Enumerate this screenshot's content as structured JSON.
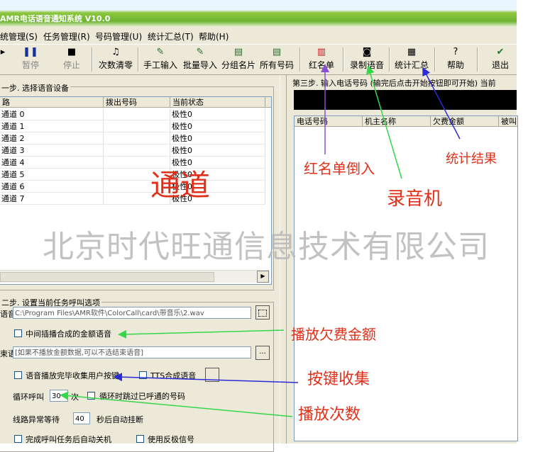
{
  "window": {
    "title": "AMR电话语音通知系统 V10.0"
  },
  "menu": [
    {
      "label": "统管理(S)"
    },
    {
      "label": "任务管理(R)"
    },
    {
      "label": "号码管理(U)"
    },
    {
      "label": "统计汇总(T)"
    },
    {
      "label": "帮助(H)"
    }
  ],
  "toolbar": [
    {
      "label": "",
      "icon": "run-icon"
    },
    {
      "label": "暂停",
      "icon": "pause-icon"
    },
    {
      "label": "停止",
      "icon": "stop-icon"
    },
    {
      "label": "次数清零",
      "icon": "music-note-icon"
    },
    {
      "label": "手工输入",
      "icon": "edit-icon"
    },
    {
      "label": "批量导入",
      "icon": "import-icon"
    },
    {
      "label": "分组名片",
      "icon": "card-icon"
    },
    {
      "label": "所有号码",
      "icon": "card-icon"
    },
    {
      "label": "红名单",
      "icon": "book-icon"
    },
    {
      "label": "录制语音",
      "icon": "recorder-icon"
    },
    {
      "label": "统计汇总",
      "icon": "stats-icon"
    },
    {
      "label": "帮助",
      "icon": "help-icon"
    },
    {
      "label": "退出",
      "icon": "check-icon"
    }
  ],
  "step1": {
    "title": "一步. 选择语音设备",
    "columns": [
      "路",
      "拨出号码",
      "当前状态"
    ],
    "rows": [
      {
        "line": "通道 0",
        "number": "",
        "status": "极性0"
      },
      {
        "line": "通道 1",
        "number": "",
        "status": "极性0"
      },
      {
        "line": "通道 2",
        "number": "",
        "status": "极性0"
      },
      {
        "line": "通道 3",
        "number": "",
        "status": "极性0"
      },
      {
        "line": "通道 4",
        "number": "",
        "status": "极性0"
      },
      {
        "line": "通道 5",
        "number": "",
        "status": "极性0"
      },
      {
        "line": "通道 6",
        "number": "",
        "status": "极性0"
      },
      {
        "line": "通道 7",
        "number": "",
        "status": "极性0"
      }
    ]
  },
  "step2": {
    "title": "二步. 设置当前任务呼叫选项",
    "voice_label": "语音",
    "voice_path": "C:\\Program Files\\AMR软件\\ColorCall\\card\\带音乐\\2.wav",
    "insert_amount_label": "中间插播合成的金额语音",
    "end_voice_label": "束语音",
    "end_voice_placeholder": "[如果不播放金额数据,可以不选结束语音]",
    "collect_keys_label": "语音播放完毕收集用户按键",
    "tts_label": "TTS合成语音",
    "loop_label": "循环呼叫",
    "loop_value": "30",
    "loop_unit": "次",
    "skip_label": "循环时跳过已呼通的号码",
    "wait_label": "线路异常等待",
    "wait_value": "40",
    "wait_unit": "秒后自动挂断",
    "shutdown_label": "完成呼叫任务后自动关机",
    "reverse_label": "使用反极信号",
    "browse_label": "..."
  },
  "step3": {
    "title": "第三步. 输入电话号码 (输完后点击开始按钮即可开始) 当前",
    "columns": [
      "电话号码",
      "机主名称",
      "欠费金额",
      "被叫"
    ]
  },
  "annotations": {
    "channel": "通道",
    "watermark": "北京时代旺通信息技术有限公司",
    "redlist": "红名单倒入",
    "recorder": "录音机",
    "stats": "统计结果",
    "play_amount": "播放欠费金额",
    "key_collect": "按键收集",
    "play_count": "播放次数"
  },
  "colors": {
    "annotation": "#e0301a",
    "arrow_purple": "#8a4fd0",
    "arrow_green": "#36d64a",
    "arrow_blue": "#2b2bd8"
  }
}
